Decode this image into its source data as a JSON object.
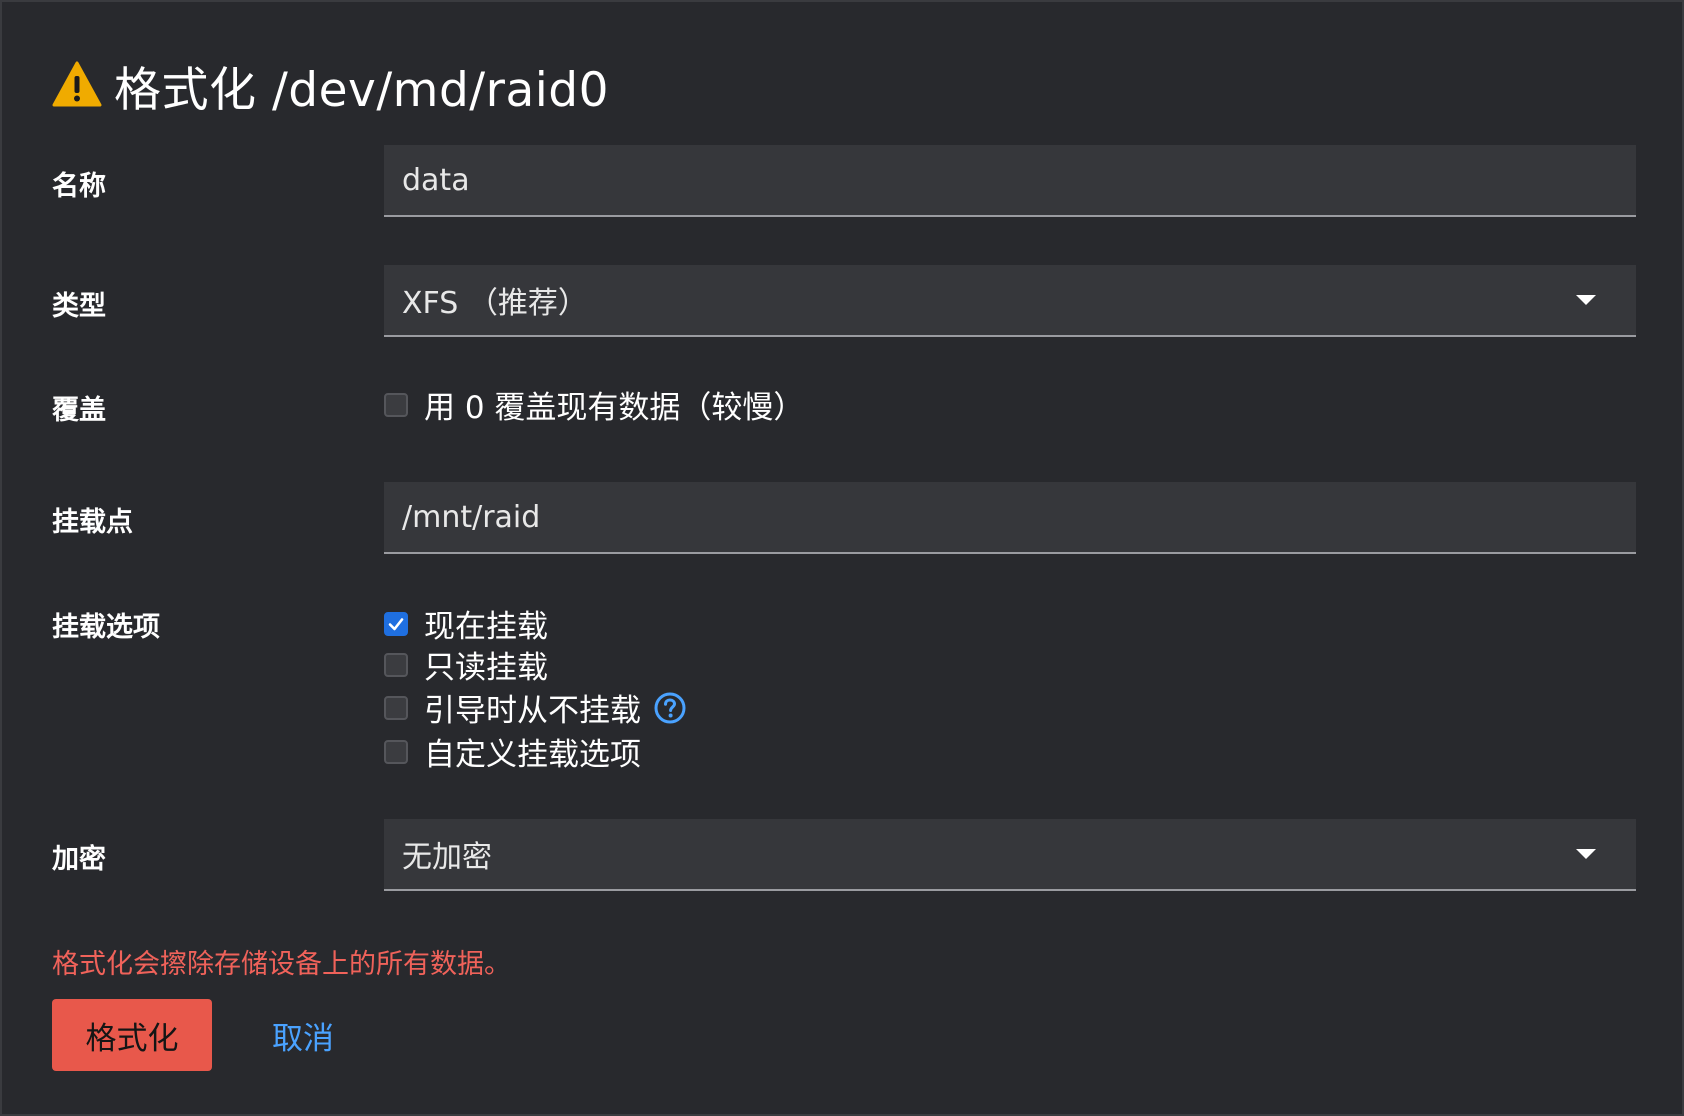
{
  "dialog": {
    "title": "格式化 /dev/md/raid0",
    "title_icon": "warning-icon",
    "warning_color": "#f0ab00"
  },
  "fields": {
    "name": {
      "label": "名称",
      "value": "data"
    },
    "type": {
      "label": "类型",
      "selected": "XFS （推荐）"
    },
    "overwrite": {
      "label": "覆盖",
      "checkbox_label": "用 0 覆盖现有数据（较慢）",
      "checked": false
    },
    "mount_point": {
      "label": "挂载点",
      "value": "/mnt/raid"
    },
    "mount_options": {
      "label": "挂载选项",
      "options": [
        {
          "label": "现在挂载",
          "checked": true
        },
        {
          "label": "只读挂载",
          "checked": false
        },
        {
          "label": "引导时从不挂载",
          "checked": false,
          "help_icon": "help-circle-icon"
        },
        {
          "label": "自定义挂载选项",
          "checked": false
        }
      ]
    },
    "encryption": {
      "label": "加密",
      "selected": "无加密"
    }
  },
  "footer": {
    "warning_text": "格式化会擦除存储设备上的所有数据。",
    "primary_button": "格式化",
    "cancel_link": "取消",
    "danger_color": "#e8584b",
    "link_color": "#4aa2ff"
  }
}
